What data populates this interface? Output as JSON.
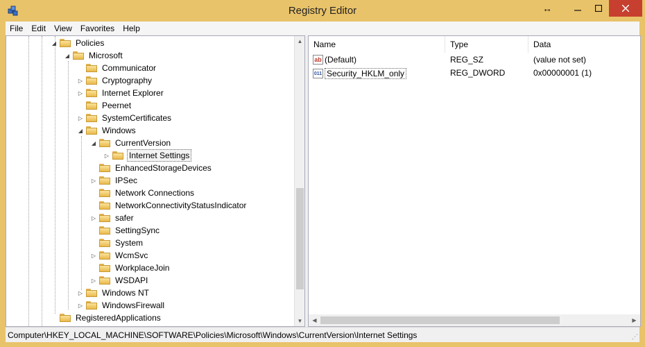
{
  "window": {
    "title": "Registry Editor"
  },
  "menu": [
    "File",
    "Edit",
    "View",
    "Favorites",
    "Help"
  ],
  "tree": [
    {
      "label": "Policies",
      "expander": "◢"
    },
    {
      "label": "Microsoft",
      "expander": "◢"
    },
    {
      "label": "Communicator",
      "expander": ""
    },
    {
      "label": "Cryptography",
      "expander": "▷"
    },
    {
      "label": "Internet Explorer",
      "expander": "▷"
    },
    {
      "label": "Peernet",
      "expander": ""
    },
    {
      "label": "SystemCertificates",
      "expander": "▷"
    },
    {
      "label": "Windows",
      "expander": "◢"
    },
    {
      "label": "CurrentVersion",
      "expander": "◢"
    },
    {
      "label": "Internet Settings",
      "expander": "▷"
    },
    {
      "label": "EnhancedStorageDevices",
      "expander": ""
    },
    {
      "label": "IPSec",
      "expander": "▷"
    },
    {
      "label": "Network Connections",
      "expander": ""
    },
    {
      "label": "NetworkConnectivityStatusIndicator",
      "expander": ""
    },
    {
      "label": "safer",
      "expander": "▷"
    },
    {
      "label": "SettingSync",
      "expander": ""
    },
    {
      "label": "System",
      "expander": ""
    },
    {
      "label": "WcmSvc",
      "expander": "▷"
    },
    {
      "label": "WorkplaceJoin",
      "expander": ""
    },
    {
      "label": "WSDAPI",
      "expander": "▷"
    },
    {
      "label": "Windows NT",
      "expander": "▷"
    },
    {
      "label": "WindowsFirewall",
      "expander": "▷"
    },
    {
      "label": "RegisteredApplications",
      "expander": ""
    }
  ],
  "list": {
    "columns": [
      "Name",
      "Type",
      "Data"
    ],
    "rows": [
      {
        "name": "(Default)",
        "type": "REG_SZ",
        "data": "(value not set)",
        "icon": "ab"
      },
      {
        "name": "Security_HKLM_only",
        "type": "REG_DWORD",
        "data": "0x00000001 (1)",
        "icon": "011"
      }
    ]
  },
  "status": {
    "path": "Computer\\HKEY_LOCAL_MACHINE\\SOFTWARE\\Policies\\Microsoft\\Windows\\CurrentVersion\\Internet Settings"
  }
}
